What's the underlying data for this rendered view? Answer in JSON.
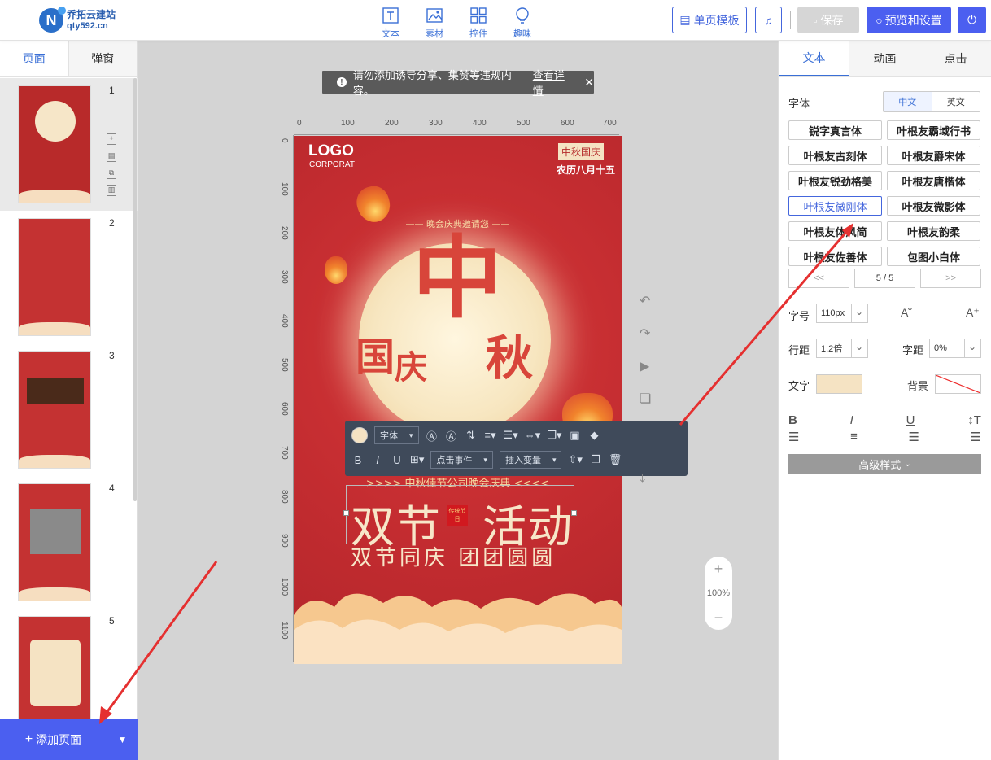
{
  "header": {
    "brand_line1": "乔拓云建站",
    "brand_line2": "qty592.cn",
    "logo_letter": "N",
    "tools": [
      {
        "label": "文本",
        "icon": "text-icon"
      },
      {
        "label": "素材",
        "icon": "image-icon"
      },
      {
        "label": "控件",
        "icon": "grid-icon"
      },
      {
        "label": "趣味",
        "icon": "bulb-icon"
      }
    ],
    "template_label": "单页模板",
    "save_label": "保存",
    "preview_label": "预览和设置"
  },
  "left_panel": {
    "tabs": [
      "页面",
      "弹窗"
    ],
    "pages": [
      "1",
      "2",
      "3",
      "4",
      "5"
    ],
    "add_page_label": "添加页面"
  },
  "notice": {
    "text": "请勿添加诱导分享、集赞等违规内容。",
    "link": "查看详情"
  },
  "ruler": {
    "h_ticks": [
      "0",
      "100",
      "200",
      "300",
      "400",
      "500",
      "600",
      "700"
    ],
    "v_ticks": [
      "0",
      "100",
      "200",
      "300",
      "400",
      "500",
      "600",
      "700",
      "800",
      "900",
      "1000",
      "1100"
    ]
  },
  "poster": {
    "logo": "LOGO",
    "logo_sub": "CORPORAT",
    "badge": "中秋国庆",
    "lunar_date": "农历八月十五",
    "invite": "—— 晚会庆典邀请您 ——",
    "big_zhong": "中",
    "big_guo": "国",
    "big_qing": "庆",
    "big_qiu": "秋",
    "subtitle": ">>>> 中秋佳节公司晚会庆典 <<<<",
    "title_part1": "双节",
    "title_part2": "活动",
    "seal_text": "传统节日",
    "tagline": "双节同庆 团团圆圆"
  },
  "format_bar": {
    "font_dropdown": "字体",
    "click_event": "点击事件",
    "insert_var": "插入变量"
  },
  "zoom": {
    "value": "100%"
  },
  "right_panel": {
    "tabs": [
      "文本",
      "动画",
      "点击"
    ],
    "font_label": "字体",
    "lang_options": [
      "中文",
      "英文"
    ],
    "fonts": [
      "锐字真言体",
      "叶根友霸域行书",
      "叶根友古刻体",
      "叶根友爵宋体",
      "叶根友锐劲格美",
      "叶根友唐楷体",
      "叶根友微刚体",
      "叶根友微影体",
      "叶根友体风简",
      "叶根友韵柔",
      "叶根友佐善体",
      "包图小白体"
    ],
    "pager_prev": "<<",
    "pager_current": "5 / 5",
    "pager_next": ">>",
    "size_label": "字号",
    "size_value": "110px",
    "line_height_label": "行距",
    "line_height_value": "1.2倍",
    "letter_spacing_label": "字距",
    "letter_spacing_value": "0%",
    "text_color_label": "文字",
    "text_color": "#f5e3c3",
    "bg_label": "背景",
    "advanced_label": "高级样式"
  },
  "colors": {
    "accent": "#4b5ff0",
    "poster_red": "#c32c30",
    "gold_text": "#f7e6c8"
  }
}
